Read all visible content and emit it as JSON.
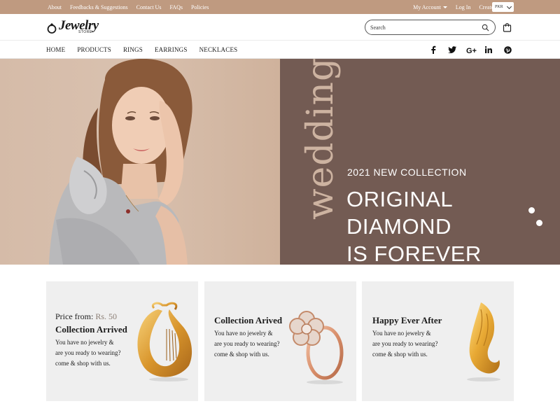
{
  "topbar": {
    "links": [
      "About",
      "Feedbacks & Suggestions",
      "Contact Us",
      "FAQs",
      "Policies"
    ],
    "account": "My Account",
    "login": "Log In",
    "create_account": "Create Account",
    "currency": "PKR"
  },
  "header": {
    "logo_text": "Jewelry",
    "logo_sub": "STORE",
    "search_placeholder": "Search"
  },
  "nav": {
    "items": [
      "HOME",
      "PRODUCTS",
      "RINGS",
      "EARRINGS",
      "NECKLACES"
    ],
    "social": [
      "facebook-icon",
      "twitter-icon",
      "google-plus-icon",
      "linkedin-icon",
      "pinterest-icon"
    ]
  },
  "hero": {
    "vertical_text": "wedding",
    "eyebrow": "2021 NEW COLLECTION",
    "title_lines": [
      "ORIGINAL",
      "DIAMOND",
      "IS FOREVER"
    ],
    "slides": 2
  },
  "cards": [
    {
      "price_prefix": "Price from:",
      "price": "Rs. 50",
      "title": "Collection Arrived",
      "lines": [
        "You have no jewelry &",
        "are you ready to wearing?",
        "come & shop with us."
      ]
    },
    {
      "title": "Collection Arived",
      "lines": [
        "You have no jewelry &",
        "are you ready to wearing?",
        "come & shop with us."
      ]
    },
    {
      "title": "Happy Ever After",
      "lines": [
        "You have no jewelry &",
        "are you ready to wearing?",
        "come & shop with us."
      ]
    }
  ],
  "colors": {
    "topbar": "#bf9a80",
    "hero_right": "#735b53",
    "hero_left": "#d5bba8",
    "card_bg": "#efefef",
    "price_accent": "#8b7e74",
    "gold": "#e2a33a"
  }
}
